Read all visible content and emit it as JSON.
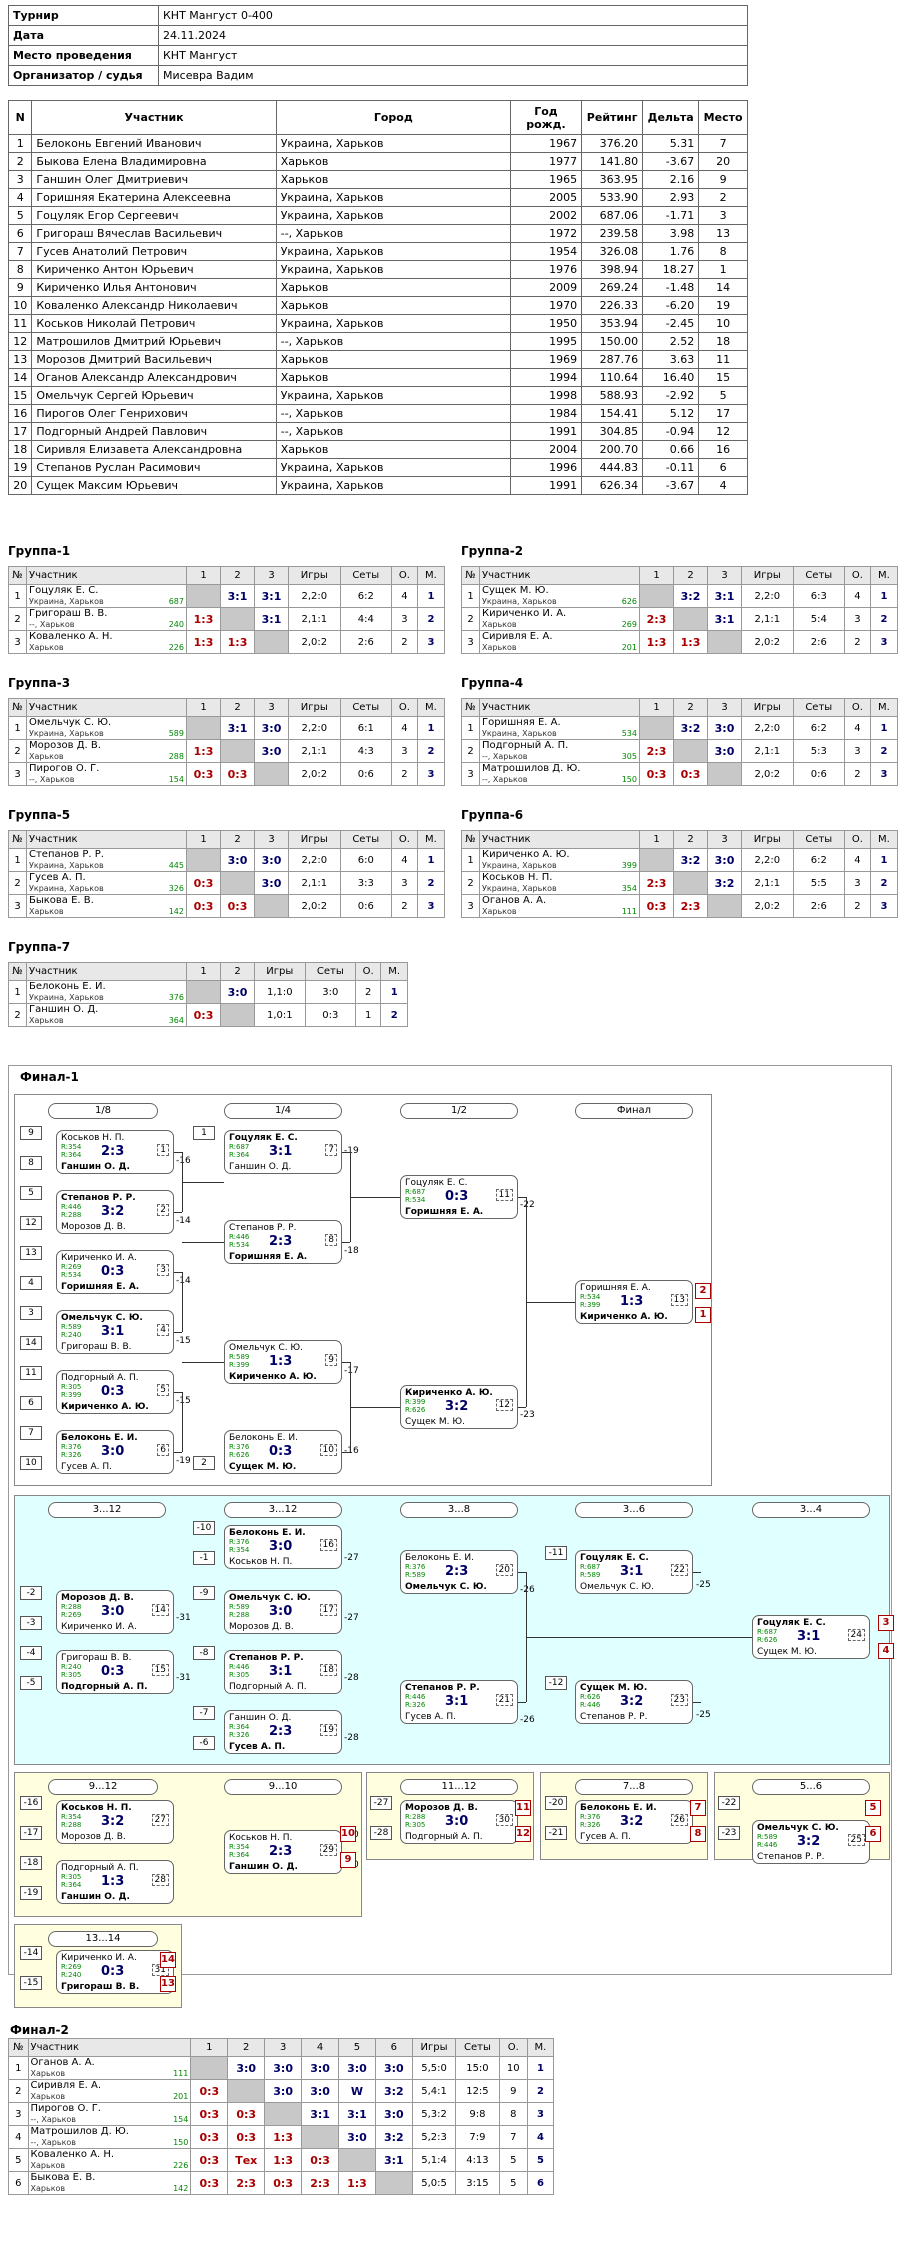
{
  "info": [
    {
      "k": "Турнир",
      "v": "КНТ Мангуст 0-400"
    },
    {
      "k": "Дата",
      "v": "24.11.2024"
    },
    {
      "k": "Место проведения",
      "v": "КНТ Мангуст"
    },
    {
      "k": "Организатор / судья",
      "v": "Мисевра Вадим"
    }
  ],
  "players_header": [
    "N",
    "Участник",
    "Город",
    "Год рожд.",
    "Рейтинг",
    "Дельта",
    "Место"
  ],
  "players": [
    [
      "1",
      "Белоконь Евгений Иванович",
      "Украина, Харьков",
      "1967",
      "376.20",
      "5.31",
      "7"
    ],
    [
      "2",
      "Быкова Елена Владимировна",
      "Харьков",
      "1977",
      "141.80",
      "-3.67",
      "20"
    ],
    [
      "3",
      "Ганшин Олег Дмитриевич",
      "Харьков",
      "1965",
      "363.95",
      "2.16",
      "9"
    ],
    [
      "4",
      "Горишняя Екатерина Алексеевна",
      "Украина, Харьков",
      "2005",
      "533.90",
      "2.93",
      "2"
    ],
    [
      "5",
      "Гоцуляк Егор Сергеевич",
      "Украина, Харьков",
      "2002",
      "687.06",
      "-1.71",
      "3"
    ],
    [
      "6",
      "Григораш Вячеслав Васильевич",
      "--, Харьков",
      "1972",
      "239.58",
      "3.98",
      "13"
    ],
    [
      "7",
      "Гусев Анатолий Петрович",
      "Украина, Харьков",
      "1954",
      "326.08",
      "1.76",
      "8"
    ],
    [
      "8",
      "Кириченко Антон Юрьевич",
      "Украина, Харьков",
      "1976",
      "398.94",
      "18.27",
      "1"
    ],
    [
      "9",
      "Кириченко Илья Антонович",
      "Харьков",
      "2009",
      "269.24",
      "-1.48",
      "14"
    ],
    [
      "10",
      "Коваленко Александр Николаевич",
      "Харьков",
      "1970",
      "226.33",
      "-6.20",
      "19"
    ],
    [
      "11",
      "Коськов Николай Петрович",
      "Украина, Харьков",
      "1950",
      "353.94",
      "-2.45",
      "10"
    ],
    [
      "12",
      "Матрошилов Дмитрий Юрьевич",
      "--, Харьков",
      "1995",
      "150.00",
      "2.52",
      "18"
    ],
    [
      "13",
      "Морозов Дмитрий Васильевич",
      "Харьков",
      "1969",
      "287.76",
      "3.63",
      "11"
    ],
    [
      "14",
      "Оганов Александр Александрович",
      "Харьков",
      "1994",
      "110.64",
      "16.40",
      "15"
    ],
    [
      "15",
      "Омельчук Сергей Юрьевич",
      "Украина, Харьков",
      "1998",
      "588.93",
      "-2.92",
      "5"
    ],
    [
      "16",
      "Пирогов Олег Генрихович",
      "--, Харьков",
      "1984",
      "154.41",
      "5.12",
      "17"
    ],
    [
      "17",
      "Подгорный Андрей Павлович",
      "--, Харьков",
      "1991",
      "304.85",
      "-0.94",
      "12"
    ],
    [
      "18",
      "Сиривля Елизавета Александровна",
      "Харьков",
      "2004",
      "200.70",
      "0.66",
      "16"
    ],
    [
      "19",
      "Степанов Руслан Расимович",
      "Украина, Харьков",
      "1996",
      "444.83",
      "-0.11",
      "6"
    ],
    [
      "20",
      "Сущек Максим Юрьевич",
      "Украина, Харьков",
      "1991",
      "626.34",
      "-3.67",
      "4"
    ]
  ],
  "group_header": [
    "№",
    "Участник",
    "Игры",
    "Сеты",
    "О.",
    "М."
  ],
  "groups": [
    {
      "title": "Группа-1",
      "rows": [
        {
          "n": "1",
          "name": "Гоцуляк Е. С.",
          "city": "Украина, Харьков",
          "r": "687",
          "sc": [
            "",
            "3:1",
            "3:1"
          ],
          "g": "2,2:0",
          "s": "6:2",
          "o": "4",
          "m": "1"
        },
        {
          "n": "2",
          "name": "Григораш В. В.",
          "city": "--, Харьков",
          "r": "240",
          "sc": [
            "1:3",
            "",
            "3:1"
          ],
          "g": "2,1:1",
          "s": "4:4",
          "o": "3",
          "m": "2"
        },
        {
          "n": "3",
          "name": "Коваленко А. Н.",
          "city": "Харьков",
          "r": "226",
          "sc": [
            "1:3",
            "1:3",
            ""
          ],
          "g": "2,0:2",
          "s": "2:6",
          "o": "2",
          "m": "3"
        }
      ]
    },
    {
      "title": "Группа-2",
      "rows": [
        {
          "n": "1",
          "name": "Сущек М. Ю.",
          "city": "Украина, Харьков",
          "r": "626",
          "sc": [
            "",
            "3:2",
            "3:1"
          ],
          "g": "2,2:0",
          "s": "6:3",
          "o": "4",
          "m": "1"
        },
        {
          "n": "2",
          "name": "Кириченко И. А.",
          "city": "Харьков",
          "r": "269",
          "sc": [
            "2:3",
            "",
            "3:1"
          ],
          "g": "2,1:1",
          "s": "5:4",
          "o": "3",
          "m": "2"
        },
        {
          "n": "3",
          "name": "Сиривля Е. А.",
          "city": "Харьков",
          "r": "201",
          "sc": [
            "1:3",
            "1:3",
            ""
          ],
          "g": "2,0:2",
          "s": "2:6",
          "o": "2",
          "m": "3"
        }
      ]
    },
    {
      "title": "Группа-3",
      "rows": [
        {
          "n": "1",
          "name": "Омельчук С. Ю.",
          "city": "Украина, Харьков",
          "r": "589",
          "sc": [
            "",
            "3:1",
            "3:0"
          ],
          "g": "2,2:0",
          "s": "6:1",
          "o": "4",
          "m": "1"
        },
        {
          "n": "2",
          "name": "Морозов Д. В.",
          "city": "Харьков",
          "r": "288",
          "sc": [
            "1:3",
            "",
            "3:0"
          ],
          "g": "2,1:1",
          "s": "4:3",
          "o": "3",
          "m": "2"
        },
        {
          "n": "3",
          "name": "Пирогов О. Г.",
          "city": "--, Харьков",
          "r": "154",
          "sc": [
            "0:3",
            "0:3",
            ""
          ],
          "g": "2,0:2",
          "s": "0:6",
          "o": "2",
          "m": "3"
        }
      ]
    },
    {
      "title": "Группа-4",
      "rows": [
        {
          "n": "1",
          "name": "Горишняя Е. А.",
          "city": "Украина, Харьков",
          "r": "534",
          "sc": [
            "",
            "3:2",
            "3:0"
          ],
          "g": "2,2:0",
          "s": "6:2",
          "o": "4",
          "m": "1"
        },
        {
          "n": "2",
          "name": "Подгорный А. П.",
          "city": "--, Харьков",
          "r": "305",
          "sc": [
            "2:3",
            "",
            "3:0"
          ],
          "g": "2,1:1",
          "s": "5:3",
          "o": "3",
          "m": "2"
        },
        {
          "n": "3",
          "name": "Матрошилов Д. Ю.",
          "city": "--, Харьков",
          "r": "150",
          "sc": [
            "0:3",
            "0:3",
            ""
          ],
          "g": "2,0:2",
          "s": "0:6",
          "o": "2",
          "m": "3"
        }
      ]
    },
    {
      "title": "Группа-5",
      "rows": [
        {
          "n": "1",
          "name": "Степанов Р. Р.",
          "city": "Украина, Харьков",
          "r": "445",
          "sc": [
            "",
            "3:0",
            "3:0"
          ],
          "g": "2,2:0",
          "s": "6:0",
          "o": "4",
          "m": "1"
        },
        {
          "n": "2",
          "name": "Гусев А. П.",
          "city": "Украина, Харьков",
          "r": "326",
          "sc": [
            "0:3",
            "",
            "3:0"
          ],
          "g": "2,1:1",
          "s": "3:3",
          "o": "3",
          "m": "2"
        },
        {
          "n": "3",
          "name": "Быкова Е. В.",
          "city": "Харьков",
          "r": "142",
          "sc": [
            "0:3",
            "0:3",
            ""
          ],
          "g": "2,0:2",
          "s": "0:6",
          "o": "2",
          "m": "3"
        }
      ]
    },
    {
      "title": "Группа-6",
      "rows": [
        {
          "n": "1",
          "name": "Кириченко А. Ю.",
          "city": "Украина, Харьков",
          "r": "399",
          "sc": [
            "",
            "3:2",
            "3:0"
          ],
          "g": "2,2:0",
          "s": "6:2",
          "o": "4",
          "m": "1"
        },
        {
          "n": "2",
          "name": "Коськов Н. П.",
          "city": "Украина, Харьков",
          "r": "354",
          "sc": [
            "2:3",
            "",
            "3:2"
          ],
          "g": "2,1:1",
          "s": "5:5",
          "o": "3",
          "m": "2"
        },
        {
          "n": "3",
          "name": "Оганов А. А.",
          "city": "Харьков",
          "r": "111",
          "sc": [
            "0:3",
            "2:3",
            ""
          ],
          "g": "2,0:2",
          "s": "2:6",
          "o": "2",
          "m": "3"
        }
      ]
    },
    {
      "title": "Группа-7",
      "rows": [
        {
          "n": "1",
          "name": "Белоконь Е. И.",
          "city": "Украина, Харьков",
          "r": "376",
          "sc": [
            "",
            "3:0"
          ],
          "g": "1,1:0",
          "s": "3:0",
          "o": "2",
          "m": "1"
        },
        {
          "n": "2",
          "name": "Ганшин О. Д.",
          "city": "Харьков",
          "r": "364",
          "sc": [
            "0:3",
            ""
          ],
          "g": "1,0:1",
          "s": "0:3",
          "o": "1",
          "m": "2"
        }
      ]
    }
  ],
  "final1": {
    "title": "Финал-1",
    "rounds": [
      "1/8",
      "1/4",
      "1/2",
      "Финал",
      "3...12",
      "3...12",
      "3...8",
      "3...6",
      "3...4",
      "9...12",
      "9...10",
      "11...12",
      "7...8",
      "5...6",
      "13...14"
    ],
    "matches": [
      {
        "p1": "Коськов Н. П.",
        "p2": "Ганшин О. Д.",
        "r1": "R:354",
        "r2": "R:364",
        "sc": "2:3",
        "num": "1"
      },
      {
        "p1": "Степанов Р. Р.",
        "p2": "Морозов Д. В.",
        "r1": "R:446",
        "r2": "R:288",
        "sc": "3:2",
        "num": "2"
      },
      {
        "p1": "Кириченко И. А.",
        "p2": "Горишняя Е. А.",
        "r1": "R:269",
        "r2": "R:534",
        "sc": "0:3",
        "num": "3"
      },
      {
        "p1": "Омельчук С. Ю.",
        "p2": "Григораш В. В.",
        "r1": "R:589",
        "r2": "R:240",
        "sc": "3:1",
        "num": "4"
      },
      {
        "p1": "Подгорный А. П.",
        "p2": "Кириченко А. Ю.",
        "r1": "R:305",
        "r2": "R:399",
        "sc": "0:3",
        "num": "5"
      },
      {
        "p1": "Белоконь Е. И.",
        "p2": "Гусев А. П.",
        "r1": "R:376",
        "r2": "R:326",
        "sc": "3:0",
        "num": "6"
      },
      {
        "p1": "Гоцуляк Е. С.",
        "p2": "Ганшин О. Д.",
        "r1": "R:687",
        "r2": "R:364",
        "sc": "3:1",
        "num": "7"
      },
      {
        "p1": "Степанов Р. Р.",
        "p2": "Горишняя Е. А.",
        "r1": "R:446",
        "r2": "R:534",
        "sc": "2:3",
        "num": "8"
      },
      {
        "p1": "Омельчук С. Ю.",
        "p2": "Кириченко А. Ю.",
        "r1": "R:589",
        "r2": "R:399",
        "sc": "1:3",
        "num": "9"
      },
      {
        "p1": "Белоконь Е. И.",
        "p2": "Сущек М. Ю.",
        "r1": "R:376",
        "r2": "R:626",
        "sc": "0:3",
        "num": "10"
      },
      {
        "p1": "Гоцуляк Е. С.",
        "p2": "Горишняя Е. А.",
        "r1": "R:687",
        "r2": "R:534",
        "sc": "0:3",
        "num": "11"
      },
      {
        "p1": "Кириченко А. Ю.",
        "p2": "Сущек М. Ю.",
        "r1": "R:399",
        "r2": "R:626",
        "sc": "3:2",
        "num": "12"
      },
      {
        "p1": "Горишняя Е. А.",
        "p2": "Кириченко А. Ю.",
        "r1": "R:534",
        "r2": "R:399",
        "sc": "1:3",
        "num": "13"
      },
      {
        "p1": "Морозов Д. В.",
        "p2": "Кириченко И. А.",
        "r1": "R:288",
        "r2": "R:269",
        "sc": "3:0",
        "num": "14"
      },
      {
        "p1": "Григораш В. В.",
        "p2": "Подгорный А. П.",
        "r1": "R:240",
        "r2": "R:305",
        "sc": "0:3",
        "num": "15"
      },
      {
        "p1": "Белоконь Е. И.",
        "p2": "Коськов Н. П.",
        "r1": "R:376",
        "r2": "R:354",
        "sc": "3:0",
        "num": "16"
      },
      {
        "p1": "Омельчук С. Ю.",
        "p2": "Морозов Д. В.",
        "r1": "R:589",
        "r2": "R:288",
        "sc": "3:0",
        "num": "17"
      },
      {
        "p1": "Степанов Р. Р.",
        "p2": "Подгорный А. П.",
        "r1": "R:446",
        "r2": "R:305",
        "sc": "3:1",
        "num": "18"
      },
      {
        "p1": "Ганшин О. Д.",
        "p2": "Гусев А. П.",
        "r1": "R:364",
        "r2": "R:326",
        "sc": "2:3",
        "num": "19"
      },
      {
        "p1": "Белоконь Е. И.",
        "p2": "Омельчук С. Ю.",
        "r1": "R:376",
        "r2": "R:589",
        "sc": "2:3",
        "num": "20"
      },
      {
        "p1": "Степанов Р. Р.",
        "p2": "Гусев А. П.",
        "r1": "R:446",
        "r2": "R:326",
        "sc": "3:1",
        "num": "21"
      },
      {
        "p1": "Гоцуляк Е. С.",
        "p2": "Омельчук С. Ю.",
        "r1": "R:687",
        "r2": "R:589",
        "sc": "3:1",
        "num": "22"
      },
      {
        "p1": "Сущек М. Ю.",
        "p2": "Степанов Р. Р.",
        "r1": "R:626",
        "r2": "R:446",
        "sc": "3:2",
        "num": "23"
      },
      {
        "p1": "Гоцуляк Е. С.",
        "p2": "Сущек М. Ю.",
        "r1": "R:687",
        "r2": "R:626",
        "sc": "3:1",
        "num": "24"
      },
      {
        "p1": "Омельчук С. Ю.",
        "p2": "Степанов Р. Р.",
        "r1": "R:589",
        "r2": "R:446",
        "sc": "3:2",
        "num": "25"
      },
      {
        "p1": "Подгорный А. П.",
        "p2": "Ганшин О. Д.",
        "r1": "R:305",
        "r2": "R:364",
        "sc": "1:3",
        "num": "28"
      },
      {
        "p1": "Коськов Н. П.",
        "p2": "Морозов Д. В.",
        "r1": "R:354",
        "r2": "R:288",
        "sc": "3:2",
        "num": "27"
      },
      {
        "p1": "Коськов Н. П.",
        "p2": "Ганшин О. Д.",
        "r1": "R:354",
        "r2": "R:364",
        "sc": "2:3",
        "num": "29"
      },
      {
        "p1": "Морозов Д. В.",
        "p2": "Подгорный А. П.",
        "r1": "R:288",
        "r2": "R:305",
        "sc": "3:0",
        "num": "30"
      },
      {
        "p1": "Белоконь Е. И.",
        "p2": "Гусев А. П.",
        "r1": "R:376",
        "r2": "R:326",
        "sc": "3:2",
        "num": "26"
      },
      {
        "p1": "Кириченко И. А.",
        "p2": "Григораш В. В.",
        "r1": "R:269",
        "r2": "R:240",
        "sc": "0:3",
        "num": "31"
      }
    ],
    "seeds": [
      "9",
      "8",
      "5",
      "12",
      "13",
      "4",
      "3",
      "14",
      "11",
      "6",
      "7",
      "10",
      "1",
      "2",
      "-10",
      "-1",
      "-2",
      "-3",
      "-9",
      "-4",
      "-5",
      "-8",
      "-7",
      "-6",
      "-11",
      "-12",
      "-16",
      "-17",
      "-18",
      "-19",
      "-27",
      "-28",
      "-20",
      "-21",
      "-22",
      "-23",
      "-14",
      "-15"
    ],
    "edge_labels": [
      "-16",
      "-14",
      "-14",
      "-15",
      "-15",
      "-19",
      "-19",
      "-18",
      "-17",
      "-16",
      "-22",
      "-23",
      "-27",
      "-27",
      "-31",
      "-31",
      "-28",
      "-28",
      "-26",
      "-26",
      "-25",
      "-25",
      "-30",
      "-30"
    ],
    "places": [
      "2",
      "1",
      "3",
      "4",
      "10",
      "9",
      "11",
      "12",
      "7",
      "8",
      "5",
      "6",
      "14",
      "13"
    ]
  },
  "final2": {
    "title": "Финал-2",
    "header": [
      "№",
      "Участник",
      "1",
      "2",
      "3",
      "4",
      "5",
      "6",
      "Игры",
      "Сеты",
      "О.",
      "М."
    ],
    "rows": [
      {
        "n": "1",
        "name": "Оганов А. А.",
        "city": "Харьков",
        "r": "111",
        "sc": [
          "",
          "3:0",
          "3:0",
          "3:0",
          "3:0",
          "3:0"
        ],
        "g": "5,5:0",
        "s": "15:0",
        "o": "10",
        "m": "1"
      },
      {
        "n": "2",
        "name": "Сиривля Е. А.",
        "city": "Харьков",
        "r": "201",
        "sc": [
          "0:3",
          "",
          "3:0",
          "3:0",
          "W",
          "3:2"
        ],
        "g": "5,4:1",
        "s": "12:5",
        "o": "9",
        "m": "2"
      },
      {
        "n": "3",
        "name": "Пирогов О. Г.",
        "city": "--, Харьков",
        "r": "154",
        "sc": [
          "0:3",
          "0:3",
          "",
          "3:1",
          "3:1",
          "3:0"
        ],
        "g": "5,3:2",
        "s": "9:8",
        "o": "8",
        "m": "3"
      },
      {
        "n": "4",
        "name": "Матрошилов Д. Ю.",
        "city": "--, Харьков",
        "r": "150",
        "sc": [
          "0:3",
          "0:3",
          "1:3",
          "",
          "3:0",
          "3:2"
        ],
        "g": "5,2:3",
        "s": "7:9",
        "o": "7",
        "m": "4"
      },
      {
        "n": "5",
        "name": "Коваленко А. Н.",
        "city": "Харьков",
        "r": "226",
        "sc": [
          "0:3",
          "Тех",
          "1:3",
          "0:3",
          "",
          "3:1"
        ],
        "g": "5,1:4",
        "s": "4:13",
        "o": "5",
        "m": "5"
      },
      {
        "n": "6",
        "name": "Быкова Е. В.",
        "city": "Харьков",
        "r": "142",
        "sc": [
          "0:3",
          "2:3",
          "0:3",
          "2:3",
          "1:3",
          ""
        ],
        "g": "5,0:5",
        "s": "3:15",
        "o": "5",
        "m": "6"
      }
    ]
  }
}
